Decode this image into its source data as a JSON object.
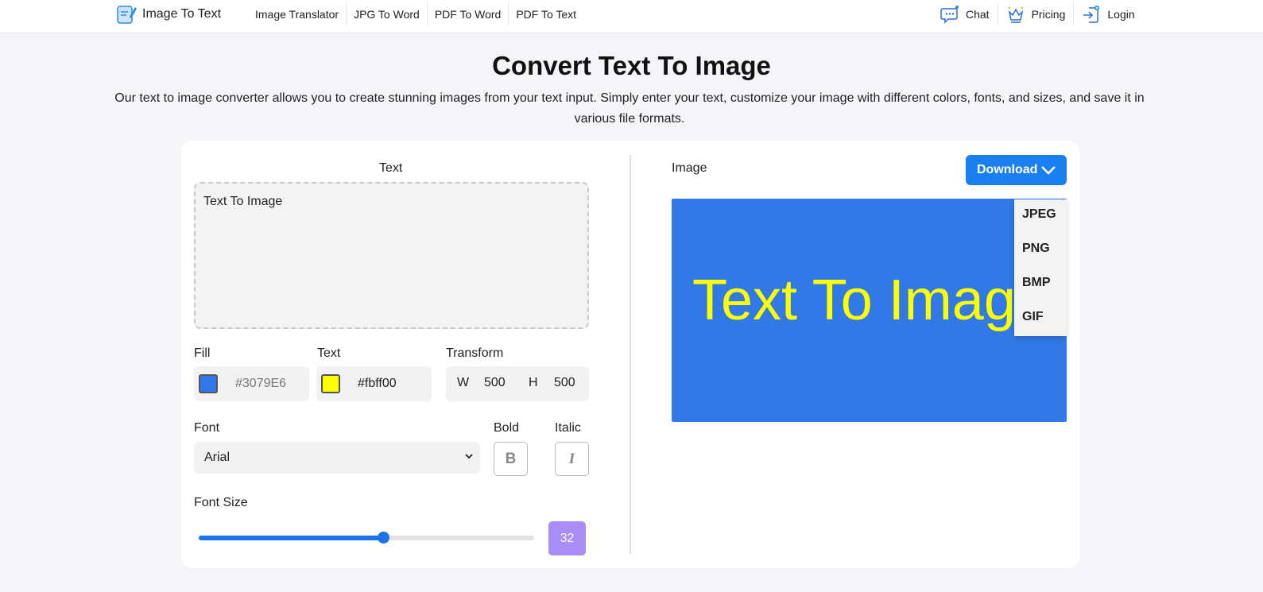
{
  "nav": {
    "brand": "Image To Text",
    "links": [
      "Image Translator",
      "JPG To Word",
      "PDF To Word",
      "PDF To Text"
    ],
    "chat": "Chat",
    "pricing": "Pricing",
    "login": "Login"
  },
  "hero": {
    "title": "Convert Text To Image",
    "subtitle": "Our text to image converter allows you to create stunning images from your text input. Simply enter your text, customize your image with different colors, fonts, and sizes, and save it in various file formats."
  },
  "editor": {
    "text_label": "Text",
    "text_value": "Text To Image",
    "fill_label": "Fill",
    "fill_value": "#3079E6",
    "text_color_label": "Text",
    "text_color_value": "#fbff00",
    "transform_label": "Transform",
    "w_label": "W",
    "w_value": "500",
    "h_label": "H",
    "h_value": "500",
    "font_label": "Font",
    "font_value": "Arial",
    "bold_label": "Bold",
    "bold_glyph": "B",
    "italic_label": "Italic",
    "italic_glyph": "I",
    "font_size_label": "Font Size",
    "font_size_value": "32",
    "font_size_fraction": 0.55
  },
  "output": {
    "image_label": "Image",
    "download_label": "Download",
    "formats": [
      "JPEG",
      "PNG",
      "BMP",
      "GIF"
    ],
    "preview_text": "Text To Image"
  },
  "colors": {
    "fill": "#3079E6",
    "text": "#fbff00",
    "accent": "#1a7ff0",
    "badge": "#a98cf6"
  }
}
